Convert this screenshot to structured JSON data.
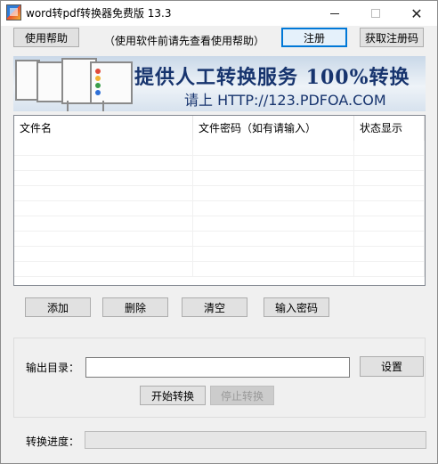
{
  "window": {
    "title": "word转pdf转换器免费版 13.3",
    "icon": "app-icon"
  },
  "toolbar": {
    "help_button": "使用帮助",
    "hint": "（使用软件前请先查看使用帮助）",
    "register_button": "注册",
    "get_code_button": "获取注册码"
  },
  "banner": {
    "title": "提供人工转换服务 100%转换",
    "subtitle": "请上  HTTP://123.PDFOA.COM"
  },
  "file_list": {
    "columns": [
      "文件名",
      "文件密码（如有请输入）",
      "状态显示"
    ],
    "rows": []
  },
  "actions": {
    "add": "添加",
    "delete": "删除",
    "clear": "清空",
    "input_password": "输入密码"
  },
  "output": {
    "label": "输出目录：",
    "value": "",
    "settings_button": "设置",
    "start_button": "开始转换",
    "stop_button": "停止转换"
  },
  "progress": {
    "label": "转换进度：",
    "value": 0
  },
  "colors": {
    "banner_text": "#17346e",
    "progress_fill": "#06b025",
    "focus_border": "#0078d7"
  }
}
